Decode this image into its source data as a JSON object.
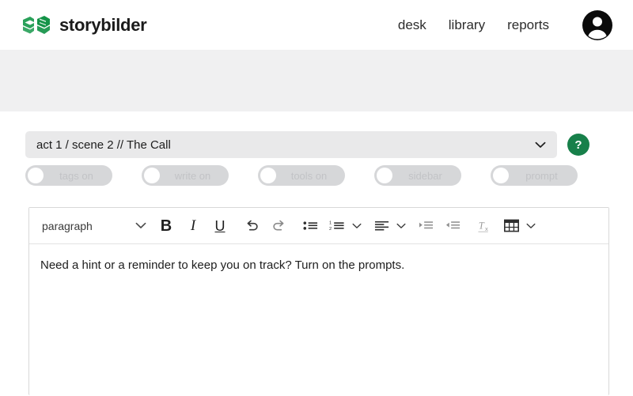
{
  "header": {
    "brand_name": "storybilder",
    "logo_icon": "books-logo-icon",
    "nav": [
      {
        "label": "desk",
        "name": "desk"
      },
      {
        "label": "library",
        "name": "library"
      },
      {
        "label": "reports",
        "name": "reports"
      }
    ],
    "avatar_icon": "user-avatar-icon"
  },
  "controls": {
    "scene_select_value": "act 1 / scene 2 // The Call",
    "scene_select_icon": "chevron-down-icon",
    "help_label": "?",
    "help_icon": "question-mark-icon",
    "accent_green": "#17804a"
  },
  "toggles": [
    {
      "label": "tags on",
      "name": "tags"
    },
    {
      "label": "write on",
      "name": "write"
    },
    {
      "label": "tools on",
      "name": "tools"
    },
    {
      "label": "sidebar",
      "name": "sidebar"
    },
    {
      "label": "prompt",
      "name": "prompt"
    }
  ],
  "editor": {
    "block_format": "paragraph",
    "toolbar": {
      "bold": "B",
      "italic": "I",
      "underline": "U",
      "undo_icon": "undo-arrow-icon",
      "redo_icon": "redo-arrow-icon",
      "bullet_list_icon": "bullet-list-icon",
      "numbered_list_icon": "numbered-list-icon",
      "align_icon": "align-left-icon",
      "indent_icon": "indent-increase-icon",
      "outdent_icon": "indent-decrease-icon",
      "clear_format_icon": "clear-formatting-icon",
      "table_icon": "table-icon"
    },
    "body_text": "Need a hint or a reminder to keep you on track? Turn on the prompts."
  }
}
